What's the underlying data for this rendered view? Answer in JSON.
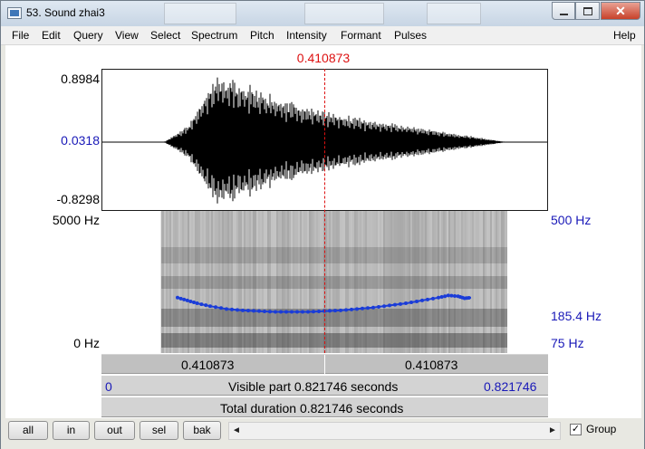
{
  "window": {
    "title": "53. Sound zhai3",
    "minimize_glyph": "",
    "maximize_glyph": "",
    "close_glyph": "✕"
  },
  "menu": [
    "File",
    "Edit",
    "Query",
    "View",
    "Select",
    "Spectrum",
    "Pitch",
    "Intensity",
    "Formant",
    "Pulses",
    "Help"
  ],
  "editor": {
    "cursor_time": "0.410873",
    "wave_labels": {
      "max": "0.8984",
      "cursor": "0.0318",
      "min": "-0.8298"
    },
    "spectrogram_labels": {
      "max": "5000 Hz",
      "min": "0 Hz"
    },
    "pitch_labels": {
      "max": "500 Hz",
      "current": "185.4 Hz",
      "min": "75 Hz"
    },
    "split_bar": {
      "left": "0.410873",
      "right": "0.410873"
    },
    "visible_bar": {
      "start": "0",
      "text": "Visible part 0.821746 seconds",
      "end": "0.821746"
    },
    "total_bar": {
      "text": "Total duration 0.821746 seconds"
    }
  },
  "buttons": {
    "all": "all",
    "in": "in",
    "out": "out",
    "sel": "sel",
    "bak": "bak"
  },
  "scroll": {
    "left": "◄",
    "right": "►"
  },
  "group": {
    "label": "Group",
    "checked": "✓"
  },
  "colors": {
    "cursor": "#dd1111",
    "pitch": "#1a3cd8",
    "label_blue": "#1919b8"
  },
  "pitch_contour": [
    [
      0.0,
      0.39
    ],
    [
      0.03,
      0.37
    ],
    [
      0.06,
      0.35
    ],
    [
      0.1,
      0.33
    ],
    [
      0.15,
      0.31
    ],
    [
      0.2,
      0.3
    ],
    [
      0.25,
      0.295
    ],
    [
      0.3,
      0.29
    ],
    [
      0.35,
      0.29
    ],
    [
      0.4,
      0.29
    ],
    [
      0.45,
      0.295
    ],
    [
      0.5,
      0.3
    ],
    [
      0.55,
      0.31
    ],
    [
      0.6,
      0.32
    ],
    [
      0.65,
      0.335
    ],
    [
      0.7,
      0.35
    ],
    [
      0.75,
      0.37
    ],
    [
      0.8,
      0.39
    ],
    [
      0.83,
      0.405
    ],
    [
      0.86,
      0.4
    ],
    [
      0.88,
      0.385
    ],
    [
      0.9,
      0.39
    ]
  ]
}
